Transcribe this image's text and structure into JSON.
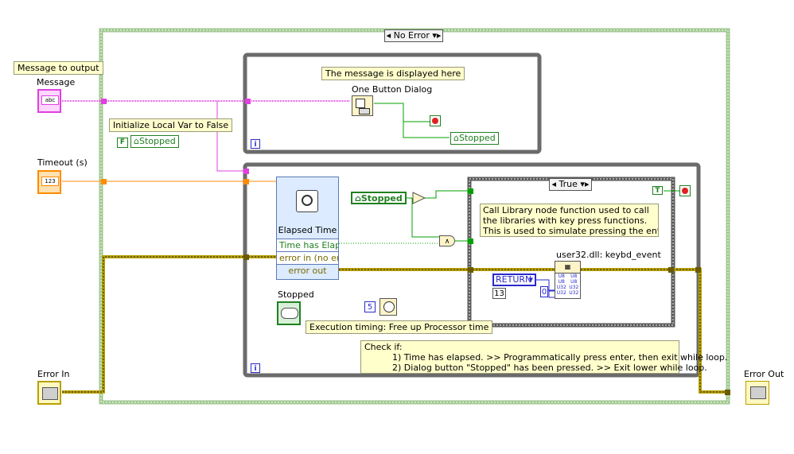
{
  "case_selector": {
    "main": "No Error",
    "inner": "True"
  },
  "labels": {
    "message_to_output": "Message to output",
    "message": "Message",
    "timeout": "Timeout (s)",
    "error_in": "Error In",
    "error_out": "Error Out",
    "stopped": "Stopped",
    "one_button_dialog": "One Button Dialog",
    "elapsed_time": "Elapsed Time",
    "user32": "user32.dll: keybd_event"
  },
  "comments": {
    "message_displayed": "The message is displayed here",
    "init_local": "Initialize Local Var to False",
    "exec_timing": "Execution timing: Free up Processor time",
    "call_library_1": "Call Library node function used to call",
    "call_library_2": "the libraries with key press functions.",
    "call_library_3": "This is used to simulate pressing the enter key",
    "check_1": "Check if:",
    "check_2": "1) Time has elapsed. >> Programmatically press enter, then exit while loop.",
    "check_3": "2) Dialog button \"Stopped\" has been pressed. >> Exit lower while loop."
  },
  "local_vars": {
    "stopped_init": "Stopped",
    "stopped_write": "Stopped",
    "stopped_read": "Stopped"
  },
  "constants": {
    "false_const": "F",
    "true_const": "T",
    "wait_ms": "5",
    "return_enum": "RETURN",
    "key_code": "13",
    "zero": "0"
  },
  "elapsed_time_terms": {
    "time_elapsed": "Time has Elaps",
    "error_in": "error in (no err",
    "error_out": "error out"
  },
  "terminal_types": {
    "message": "abc",
    "timeout": "123"
  },
  "keybd_event_terms": [
    "U8",
    "U8",
    "U8",
    "U8",
    "U32",
    "U32",
    "U32",
    "U32"
  ],
  "colors": {
    "string_wire": "#e040e0",
    "numeric_wire": "#ff8c00",
    "boolean_wire": "#00a000",
    "error_wire": "#b8a000",
    "structure": "#6b6b6b",
    "case": "#a0c890"
  }
}
